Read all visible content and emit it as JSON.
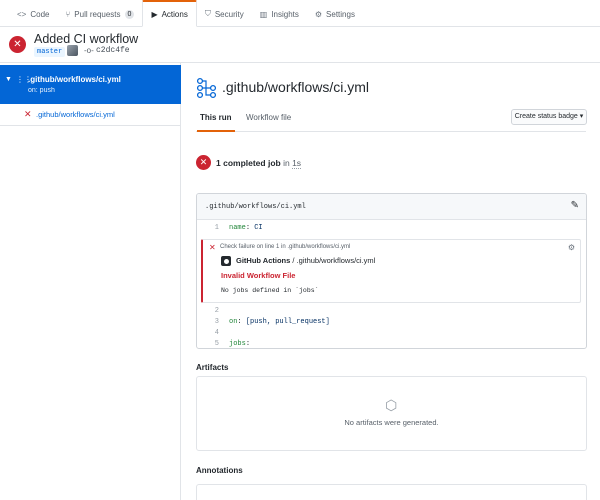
{
  "repo_nav": {
    "tabs": [
      {
        "label": "Code",
        "icon": "code-icon"
      },
      {
        "label": "Pull requests",
        "icon": "pull-request-icon",
        "count": "0"
      },
      {
        "label": "Actions",
        "icon": "play-icon",
        "active": true
      },
      {
        "label": "Security",
        "icon": "shield-icon"
      },
      {
        "label": "Insights",
        "icon": "graph-icon"
      },
      {
        "label": "Settings",
        "icon": "gear-icon"
      }
    ]
  },
  "run": {
    "title": "Added CI workflow",
    "status": "failure",
    "branch": "master",
    "commit_sha": "c2dc4fe"
  },
  "sidebar": {
    "workflow": {
      "name": ".github/workflows/ci.yml",
      "trigger": "on: push"
    },
    "jobs": [
      {
        "name": ".github/workflows/ci.yml",
        "status": "failure"
      }
    ]
  },
  "main": {
    "workflow_title": ".github/workflows/ci.yml",
    "tabs": {
      "this_run": "This run",
      "workflow_file": "Workflow file"
    },
    "status_badge_button": "Create status badge ▾",
    "jobs_summary": {
      "count_text": "1 completed job",
      "in_text": " in ",
      "duration": "1s"
    },
    "file": {
      "path": ".github/workflows/ci.yml",
      "lines": [
        {
          "n": "1",
          "key": "name",
          "sep": ": ",
          "val": "CI"
        },
        {
          "n": "2",
          "key": "",
          "sep": "",
          "val": ""
        },
        {
          "n": "3",
          "key": "on",
          "sep": ": ",
          "val": "[push, pull_request]"
        },
        {
          "n": "4",
          "key": "",
          "sep": "",
          "val": ""
        },
        {
          "n": "5",
          "key": "jobs",
          "sep": ":",
          "val": ""
        }
      ],
      "annotation": {
        "header": "Check failure on line 1 in .github/workflows/ci.yml",
        "source_bold": "GitHub Actions",
        "source_rest": " / .github/workflows/ci.yml",
        "title": "Invalid Workflow File",
        "message": "No jobs defined in `jobs`"
      }
    },
    "artifacts": {
      "title": "Artifacts",
      "empty_text": "No artifacts were generated."
    },
    "annotations": {
      "title": "Annotations"
    }
  },
  "colors": {
    "accent": "#e36209",
    "link": "#0366d6",
    "failure": "#cb2431",
    "selected": "#0366d6"
  }
}
